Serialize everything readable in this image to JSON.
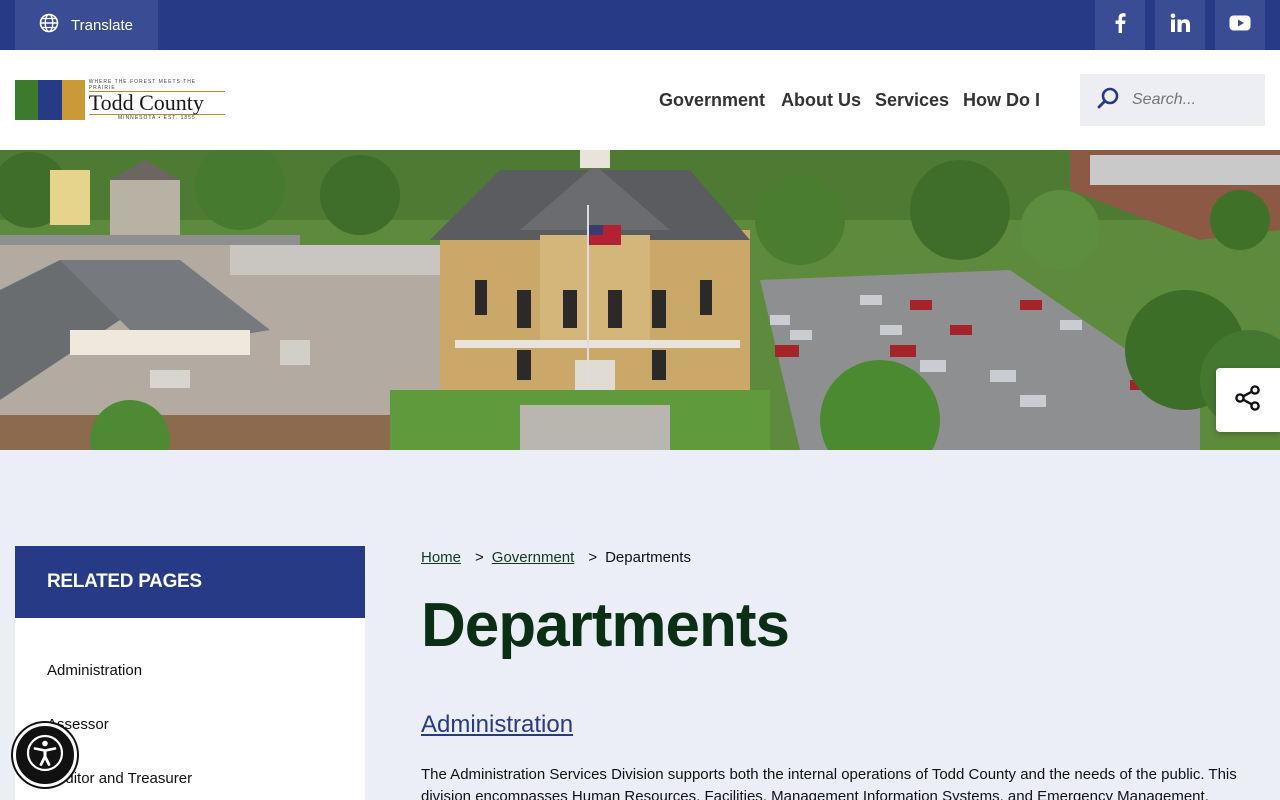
{
  "topbar": {
    "translate_label": "Translate",
    "social": [
      "facebook-icon",
      "linkedin-icon",
      "youtube-icon"
    ]
  },
  "header": {
    "logo": {
      "tagline": "WHERE THE FOREST MEETS THE PRAIRIE",
      "name": "Todd County",
      "sub": "MINNESOTA • EST. 1855"
    },
    "nav": [
      "Government",
      "About Us",
      "Services",
      "How Do I"
    ],
    "search": {
      "placeholder": "Search..."
    }
  },
  "sidebar": {
    "heading": "RELATED PAGES",
    "items": [
      "Administration",
      "Assessor",
      "Auditor and Treasurer"
    ]
  },
  "breadcrumb": {
    "items": [
      "Home",
      "Government",
      "Departments"
    ],
    "separator": ">"
  },
  "main": {
    "title": "Departments",
    "section_link": "Administration",
    "description": "The Administration Services Division supports both the internal operations of Todd County and the needs of the public. This division encompasses Human Resources, Facilities, Management Information Systems, and Emergency Management."
  },
  "colors": {
    "primary": "#273a86",
    "title_green": "#0b2f14",
    "background": "#eceef7"
  }
}
